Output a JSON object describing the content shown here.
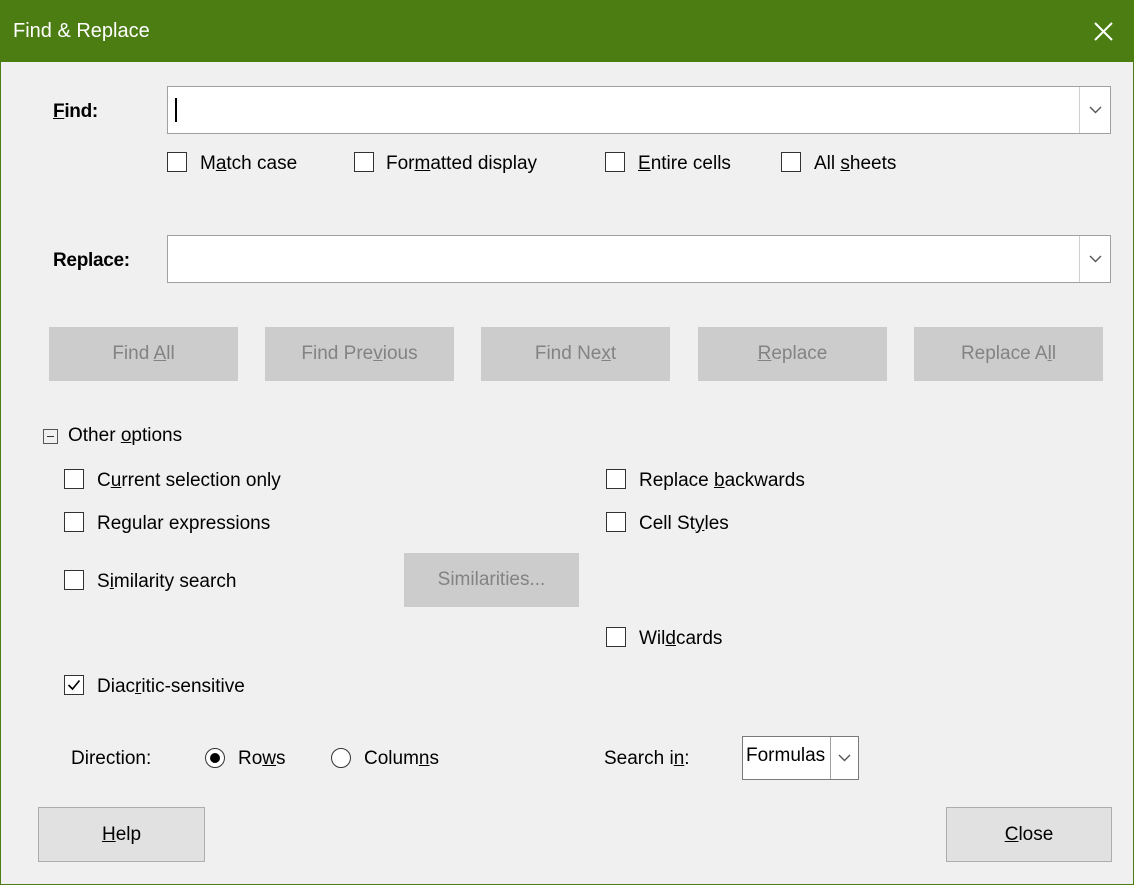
{
  "window": {
    "title": "Find & Replace"
  },
  "find": {
    "label": "Find:",
    "value": "",
    "options": [
      {
        "label": "Match case",
        "checked": false
      },
      {
        "label": "Formatted display",
        "checked": false
      },
      {
        "label": "Entire cells",
        "checked": false
      },
      {
        "label": "All sheets",
        "checked": false
      }
    ]
  },
  "replace": {
    "label": "Replace:",
    "value": ""
  },
  "buttons": {
    "find_all": "Find All",
    "find_previous": "Find Previous",
    "find_next": "Find Next",
    "replace": "Replace",
    "replace_all": "Replace All",
    "similarities": "Similarities...",
    "help": "Help",
    "close": "Close"
  },
  "other_options": {
    "label": "Other options",
    "expanded": true,
    "left": [
      {
        "label": "Current selection only",
        "checked": false
      },
      {
        "label": "Regular expressions",
        "checked": false
      },
      {
        "label": "Similarity search",
        "checked": false
      },
      {
        "label": "Diacritic-sensitive",
        "checked": true
      }
    ],
    "right": [
      {
        "label": "Replace backwards",
        "checked": false
      },
      {
        "label": "Cell Styles",
        "checked": false
      },
      {
        "label": "Wildcards",
        "checked": false
      }
    ]
  },
  "direction": {
    "label": "Direction:",
    "rows_label": "Rows",
    "columns_label": "Columns",
    "selected": "Rows"
  },
  "search_in": {
    "label": "Search in:",
    "value": "Formulas"
  },
  "colors": {
    "titlebar": "#4b7d13",
    "dialog_bg": "#f0f0f0",
    "disabled_button": "#cccccc"
  }
}
